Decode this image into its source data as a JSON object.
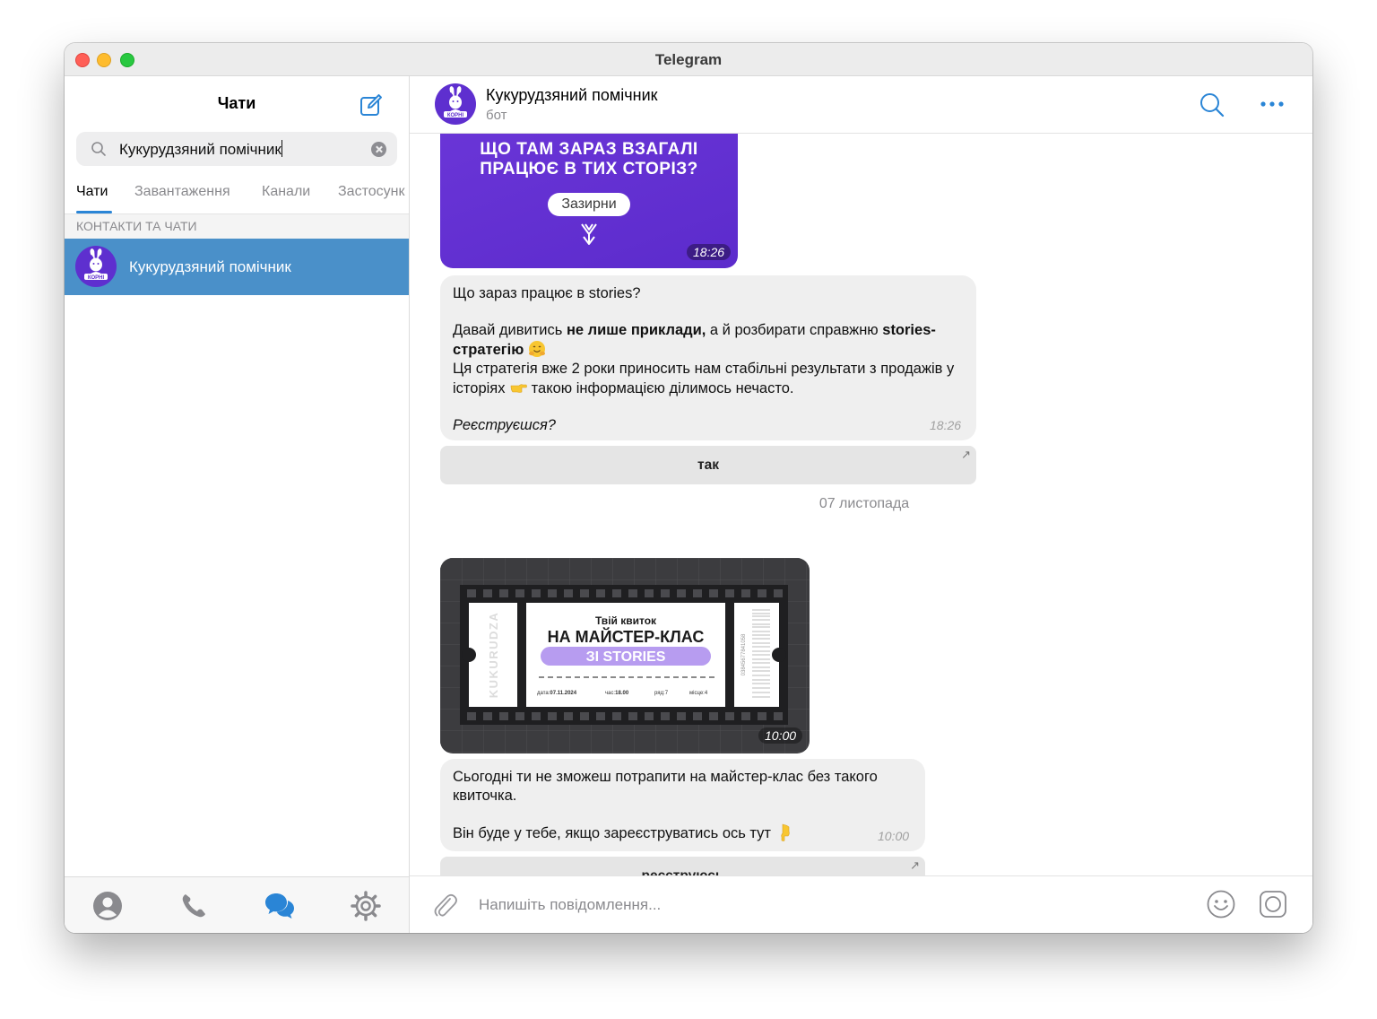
{
  "window": {
    "title": "Telegram"
  },
  "sidebar": {
    "title": "Чати",
    "search_value": "Кукурудзяний помічник",
    "tabs": [
      {
        "label": "Чати",
        "active": true
      },
      {
        "label": "Завантаження",
        "active": false
      },
      {
        "label": "Канали",
        "active": false
      },
      {
        "label": "Застосунк",
        "active": false
      }
    ],
    "section_label": "КОНТАКТИ ТА ЧАТИ",
    "chat_item": {
      "name": "Кукурудзяний помічник",
      "avatar_text": "КОРНІ"
    },
    "bottom_icons": [
      "contacts-icon",
      "calls-icon",
      "chats-icon",
      "settings-icon"
    ]
  },
  "chat": {
    "name": "Кукурудзяний помічник",
    "subtitle": "бот",
    "avatar_text": "КОРНІ"
  },
  "messages": {
    "promo": {
      "title_line1": "ЩО ТАМ ЗАРАЗ ВЗАГАЛІ",
      "title_line2": "ПРАЦЮЄ В ТИХ СТОРІЗ?",
      "button": "Зазирни",
      "time": "18:26"
    },
    "msg1": {
      "line1": "Що зараз працює в stories?",
      "p2_a": "Давай дивитись ",
      "p2_bold1": "не лише приклади,",
      "p2_b": " а й розбирати справжню ",
      "p2_bold2": "stories-стратегію",
      "p3_a": "Ця стратегія вже 2 роки приносить нам стабільні результати з продажів у історіях",
      "p3_b": " такою інформацією ділимось нечасто.",
      "p4": "Реєструєшся?",
      "time": "18:26"
    },
    "btn1": "так",
    "date_separator": "07 листопада",
    "ticket": {
      "small_title": "Твій квиток",
      "big_title": "НА МАЙСТЕР-КЛАС",
      "badge": "ЗІ STORIES",
      "side_text": "KUKURUDZA",
      "date_label": "дата:",
      "date_value": "07.11.2024",
      "time_label": "час:",
      "time_value": "18.00",
      "row_label": "ряд:",
      "row_value": "7",
      "seat_label": "місце:",
      "seat_value": "4",
      "serial": "03845677841058",
      "time": "10:00"
    },
    "msg2": {
      "line1": "Сьогодні ти не зможеш потрапити на майстер-клас без такого квиточка.",
      "line2": "Він буде у тебе, якщо зареєструватись ось тут",
      "time": "10:00"
    },
    "btn2": "реєструюсь"
  },
  "input": {
    "placeholder": "Напишіть повідомлення..."
  },
  "colors": {
    "accent": "#2a85d6",
    "selected_chat": "#4a90c9",
    "brand_purple": "#5e2fcf",
    "bubble": "#efefef"
  }
}
